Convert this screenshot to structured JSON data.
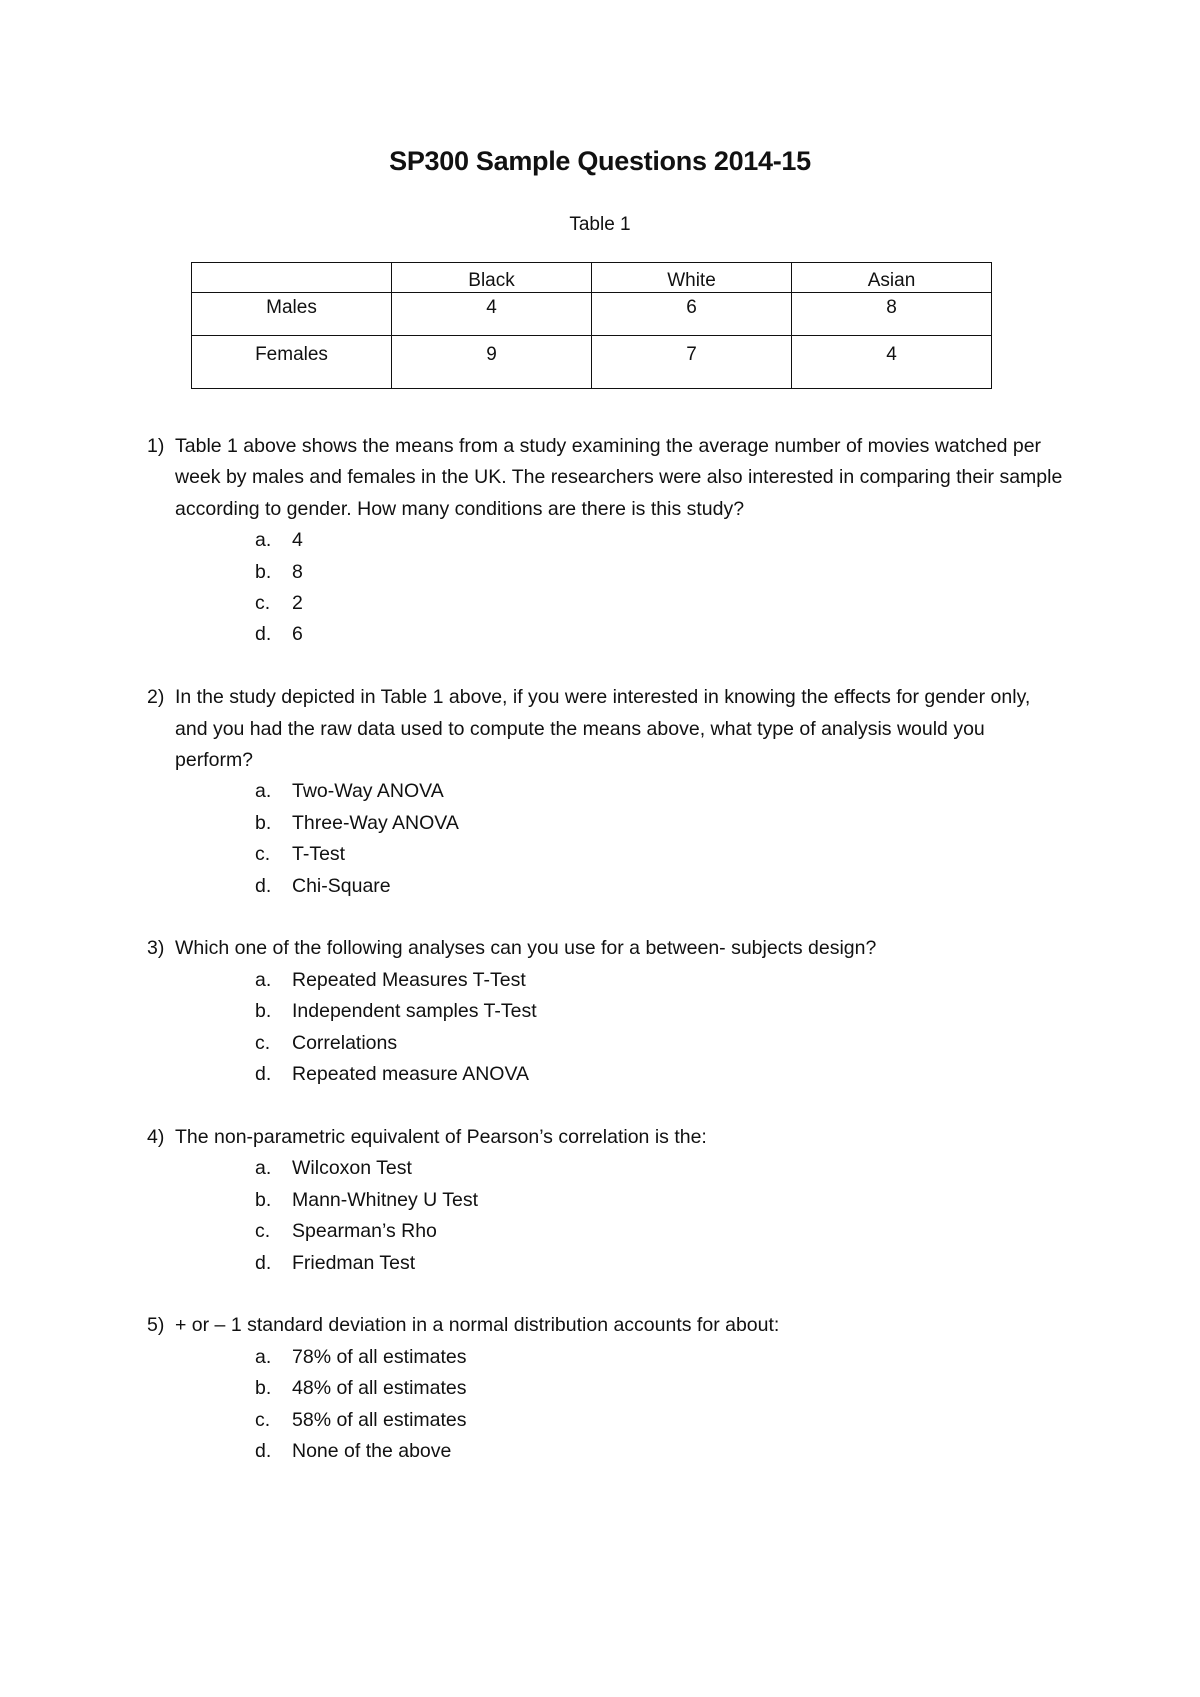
{
  "document": {
    "title": "SP300 Sample Questions 2014-15",
    "table_caption": "Table 1"
  },
  "table": {
    "headers": [
      "",
      "Black",
      "White",
      "Asian"
    ],
    "rows": [
      {
        "label": "Males",
        "values": [
          "4",
          "6",
          "8"
        ]
      },
      {
        "label": "Females",
        "values": [
          "9",
          "7",
          "4"
        ]
      }
    ]
  },
  "questions": [
    {
      "number": "1)",
      "text": "Table 1 above shows the means from a study examining the average number of movies watched per week by males and females in the UK. The researchers were also interested in comparing their sample according to gender. How many conditions are there is this study?",
      "options": [
        {
          "label": "a.",
          "text": "4"
        },
        {
          "label": "b.",
          "text": "8"
        },
        {
          "label": "c.",
          "text": "2"
        },
        {
          "label": "d.",
          "text": "6"
        }
      ]
    },
    {
      "number": "2)",
      "text": "In the study depicted in Table 1 above, if you were interested in knowing the effects for gender only, and you had the raw data used to compute the means above, what type of analysis would you perform?",
      "options": [
        {
          "label": "a.",
          "text": "Two-Way ANOVA"
        },
        {
          "label": "b.",
          "text": "Three-Way ANOVA"
        },
        {
          "label": "c.",
          "text": "T-Test"
        },
        {
          "label": "d.",
          "text": "Chi-Square"
        }
      ]
    },
    {
      "number": "3)",
      "text": "Which one of the following analyses can you use for a between- subjects design?",
      "options": [
        {
          "label": "a.",
          "text": "Repeated Measures T-Test"
        },
        {
          "label": "b.",
          "text": "Independent samples T-Test"
        },
        {
          "label": "c.",
          "text": "Correlations"
        },
        {
          "label": "d.",
          "text": "Repeated measure ANOVA"
        }
      ]
    },
    {
      "number": "4)",
      "text": "The non-parametric equivalent of Pearson’s correlation is the:",
      "options": [
        {
          "label": "a.",
          "text": "Wilcoxon Test"
        },
        {
          "label": "b.",
          "text": "Mann-Whitney U Test"
        },
        {
          "label": "c.",
          "text": "Spearman’s Rho"
        },
        {
          "label": "d.",
          "text": "Friedman Test"
        }
      ]
    },
    {
      "number": "5)",
      "text": "+ or – 1 standard deviation in a normal distribution accounts for about:",
      "options": [
        {
          "label": "a.",
          "text": "78% of all estimates"
        },
        {
          "label": "b.",
          "text": "48% of all estimates"
        },
        {
          "label": "c.",
          "text": "58% of all estimates"
        },
        {
          "label": "d.",
          "text": "None of the above"
        }
      ]
    }
  ]
}
